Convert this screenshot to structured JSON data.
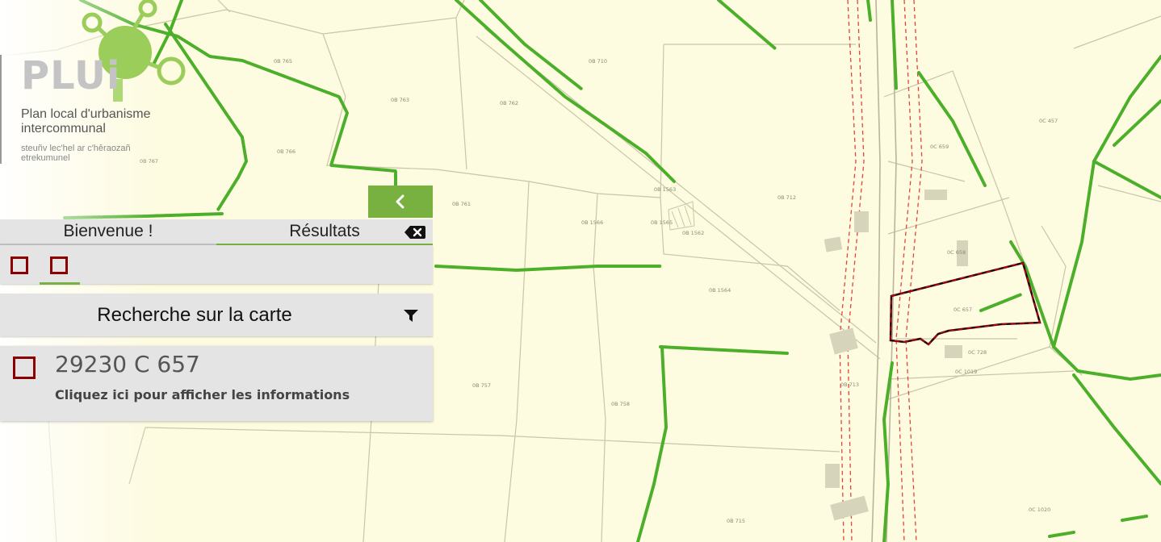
{
  "logo": {
    "main": "PLUi",
    "line1": "Plan local d'urbanisme",
    "line2": "intercommunal",
    "breton1": "steuñv lec'hel ar c'hêraozañ",
    "breton2": "etrekumunel",
    "accent_color": "#9acd5a"
  },
  "panel": {
    "collapse_icon": "chevron-left-icon",
    "tabs": [
      "Bienvenue !",
      "Résultats"
    ],
    "active_tab": "Résultats",
    "clear_icon": "backspace-x-icon",
    "search_title": "Recherche sur la carte",
    "filter_icon": "filter-icon",
    "result": {
      "id": "29230 C 657",
      "link": "Cliquez ici pour afficher les informations"
    },
    "accent_color": "#78b13f",
    "selection_color": "#8b0000"
  },
  "map": {
    "parcels": [
      "0B 765",
      "0B 763",
      "0B 762",
      "0B 710",
      "0B 766",
      "0B 767",
      "0B 1563",
      "0B 761",
      "0B 1566",
      "0B 1565",
      "0B 1562",
      "0B 712",
      "0B 1564",
      "0B 757",
      "0B 758",
      "0B 713",
      "0B 715",
      "0C 457",
      "0C 659",
      "0C 658",
      "0C 657",
      "0C 728",
      "0C 1019",
      "0C 1020"
    ],
    "hedge_color": "#4caf2a",
    "selected_parcel": "0C 657"
  }
}
